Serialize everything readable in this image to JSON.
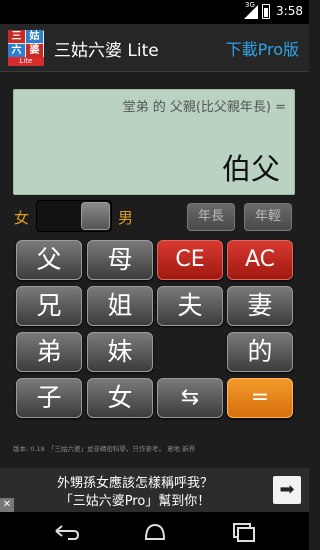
{
  "status_bar": {
    "network": "3G",
    "time": "3:58"
  },
  "action_bar": {
    "icon_cells": [
      "三",
      "姑",
      "六",
      "婆"
    ],
    "icon_badge": "Lite",
    "title": "三姑六婆 Lite",
    "pro_link": "下載Pro版"
  },
  "display": {
    "question": "堂弟 的 父親(比父親年長) =",
    "answer": "伯父"
  },
  "gender": {
    "female_label": "女",
    "male_label": "男",
    "selected": "male"
  },
  "age_buttons": {
    "older": "年長",
    "younger": "年輕"
  },
  "keypad": {
    "father": "父",
    "mother": "母",
    "ce": "CE",
    "ac": "AC",
    "older_brother": "兄",
    "older_sister": "姐",
    "husband": "夫",
    "wife": "妻",
    "younger_brother": "弟",
    "younger_sister": "妹",
    "of": "的",
    "son": "子",
    "daughter": "女",
    "swap": "⇆",
    "equals": "="
  },
  "footer": {
    "note": "版本: 0.18　「三姑六婆」並非精密科學，只作參考。 意地 新界"
  },
  "ad": {
    "line1": "外甥孫女應該怎樣稱呼我？",
    "line2": "「三姑六婆Pro」幫到你！",
    "arrow": "➡",
    "close": "✕"
  },
  "colors": {
    "display_bg": "#b9d2c1",
    "accent_red": "#c0281c",
    "accent_orange": "#e8821a",
    "pro_link": "#2ea3e3",
    "gender_label": "#e0a020"
  }
}
